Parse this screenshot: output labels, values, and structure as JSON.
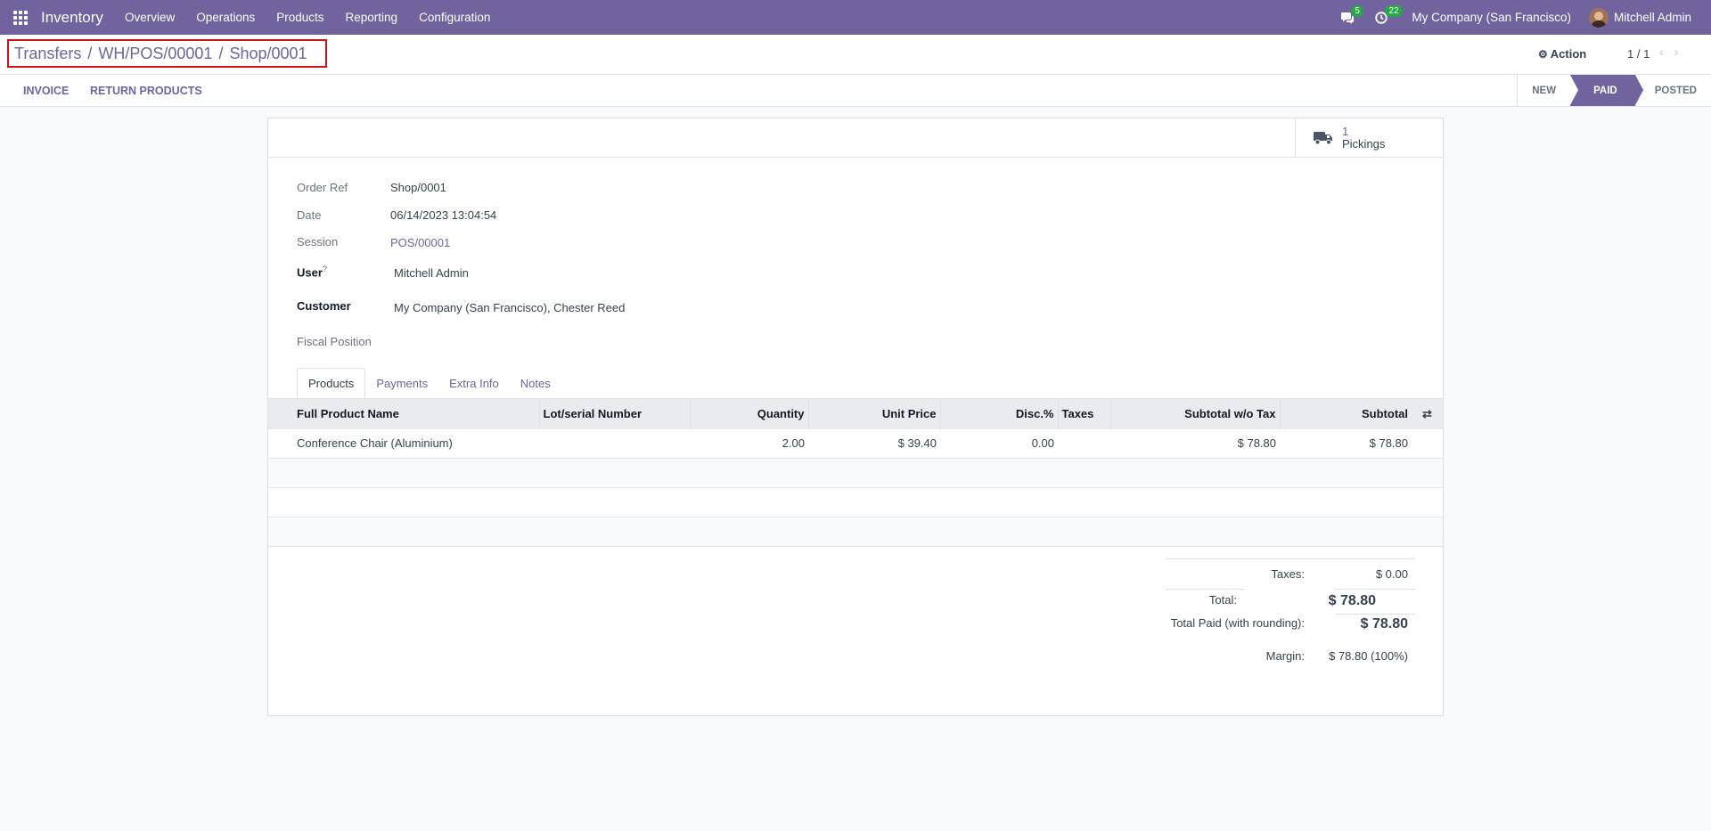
{
  "navbar": {
    "app_name": "Inventory",
    "menu": [
      "Overview",
      "Operations",
      "Products",
      "Reporting",
      "Configuration"
    ],
    "messages_count": "5",
    "activities_count": "22",
    "company": "My Company (San Francisco)",
    "user": "Mitchell Admin"
  },
  "breadcrumb": {
    "items": [
      "Transfers",
      "WH/POS/00001"
    ],
    "separator": "/",
    "current": "Shop/0001"
  },
  "control": {
    "action_label": "Action",
    "pager": "1 / 1"
  },
  "statusbar": {
    "buttons": [
      "INVOICE",
      "RETURN PRODUCTS"
    ],
    "stages": [
      "NEW",
      "PAID",
      "POSTED"
    ],
    "active_stage": "PAID"
  },
  "smart_button": {
    "count": "1",
    "label": "Pickings"
  },
  "fields": {
    "order_ref": {
      "label": "Order Ref",
      "value": "Shop/0001"
    },
    "date": {
      "label": "Date",
      "value": "06/14/2023 13:04:54"
    },
    "session": {
      "label": "Session",
      "value": "POS/00001"
    },
    "user": {
      "label": "User",
      "help": "?",
      "value": "Mitchell Admin"
    },
    "customer": {
      "label": "Customer",
      "value": "My Company (San Francisco), Chester Reed"
    },
    "fiscal_position": {
      "label": "Fiscal Position",
      "value": ""
    }
  },
  "tabs": [
    "Products",
    "Payments",
    "Extra Info",
    "Notes"
  ],
  "lines": {
    "columns": [
      "Full Product Name",
      "Lot/serial Number",
      "Quantity",
      "Unit Price",
      "Disc.%",
      "Taxes",
      "Subtotal w/o Tax",
      "Subtotal"
    ],
    "rows": [
      {
        "product": "Conference Chair (Aluminium)",
        "lot": "",
        "qty": "2.00",
        "price": "$ 39.40",
        "disc": "0.00",
        "taxes": "",
        "subtotal_wo_tax": "$ 78.80",
        "subtotal": "$ 78.80"
      }
    ]
  },
  "totals": {
    "taxes_label": "Taxes:",
    "taxes_value": "$ 0.00",
    "total_label": "Total:",
    "total_value": "$ 78.80",
    "paid_label": "Total Paid (with rounding):",
    "paid_value": "$ 78.80",
    "margin_label": "Margin:",
    "margin_value": "$ 78.80 (100%)"
  },
  "colors": {
    "brand": "#71639e",
    "highlight_border": "#d0121b",
    "badge": "#28a745"
  },
  "icons": {
    "apps": "apps-grid-icon",
    "messages": "chat-icon",
    "activities": "clock-icon",
    "action": "gear-icon",
    "prev": "chevron-left-icon",
    "next": "chevron-right-icon",
    "pickings": "truck-icon",
    "optional_columns": "sliders-icon"
  }
}
